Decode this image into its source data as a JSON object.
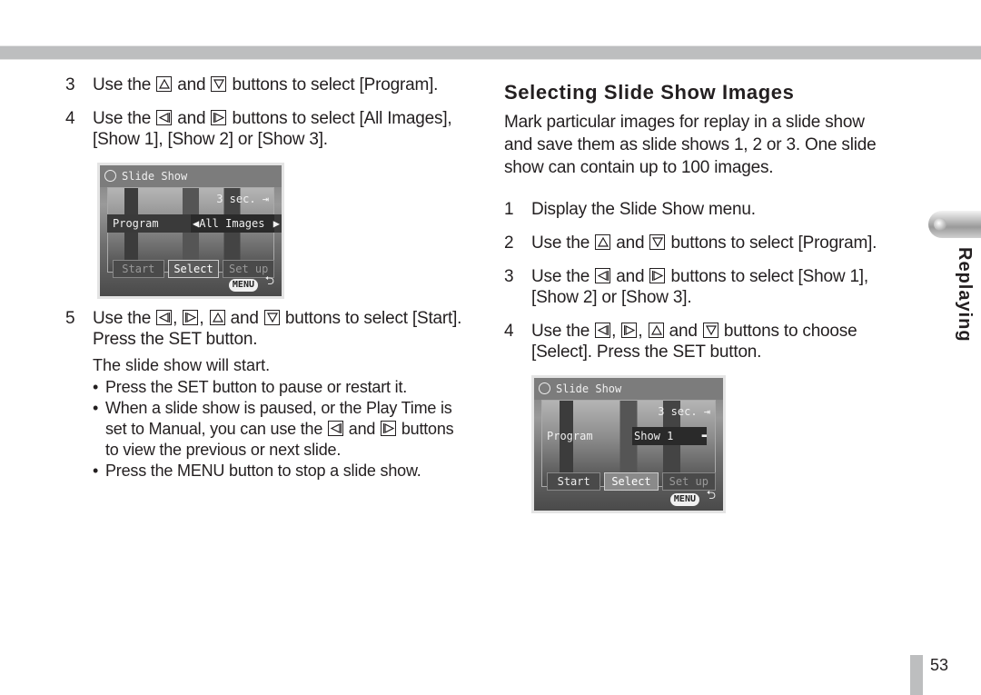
{
  "left": {
    "steps_top": [
      {
        "num": "3",
        "parts": [
          "Use the ",
          "{up}",
          " and ",
          "{down}",
          " buttons to select [Program]."
        ]
      },
      {
        "num": "4",
        "parts": [
          "Use the ",
          "{left}",
          " and ",
          "{right}",
          " buttons to select [All Images], [Show 1], [Show 2] or [Show 3]."
        ]
      }
    ],
    "lcd": {
      "title": "Slide Show",
      "interval": "3 sec. ⇥",
      "program_label": "Program",
      "program_value": "◀All Images",
      "program_arrow": "▶",
      "buttons": [
        "Start",
        "Select",
        "Set up"
      ],
      "menu_label": "MENU",
      "back_icon": "⮌"
    },
    "step5": {
      "num": "5",
      "parts": [
        "Use the ",
        "{left}",
        ", ",
        "{right}",
        ", ",
        "{up}",
        " and ",
        "{down}",
        " buttons to select [Start]. Press the SET button."
      ]
    },
    "result": "The slide show will start.",
    "bullets": [
      {
        "parts": [
          "Press the SET button to pause or restart it."
        ]
      },
      {
        "parts": [
          "When a slide show is paused, or the Play Time is set to Manual, you can use the ",
          "{left}",
          " and ",
          "{right}",
          " buttons to view the previous or next slide."
        ]
      },
      {
        "parts": [
          "Press the MENU button to stop a slide show."
        ]
      }
    ]
  },
  "right": {
    "heading": "Selecting Slide Show Images",
    "intro": "Mark particular images for replay in a slide show and save them as slide shows 1, 2 or 3. One slide show can contain up to 100 images.",
    "steps": [
      {
        "num": "1",
        "parts": [
          "Display the Slide Show menu."
        ]
      },
      {
        "num": "2",
        "parts": [
          "Use the ",
          "{up}",
          " and ",
          "{down}",
          " buttons to select [Program]."
        ]
      },
      {
        "num": "3",
        "parts": [
          "Use the ",
          "{left}",
          " and ",
          "{right}",
          " buttons to select [Show 1], [Show 2] or [Show 3]."
        ]
      },
      {
        "num": "4",
        "parts": [
          "Use the ",
          "{left}",
          ", ",
          "{right}",
          ", ",
          "{up}",
          " and ",
          "{down}",
          " buttons to choose [Select]. Press the SET button."
        ]
      }
    ],
    "lcd": {
      "title": "Slide Show",
      "interval": "3 sec. ⇥",
      "program_label": "Program",
      "program_value": "Show 1",
      "program_arrow": "▬",
      "buttons": [
        "Start",
        "Select",
        "Set up"
      ],
      "menu_label": "MENU",
      "back_icon": "⮌"
    }
  },
  "side_tab": {
    "label": "Replaying"
  },
  "page_number": "53"
}
